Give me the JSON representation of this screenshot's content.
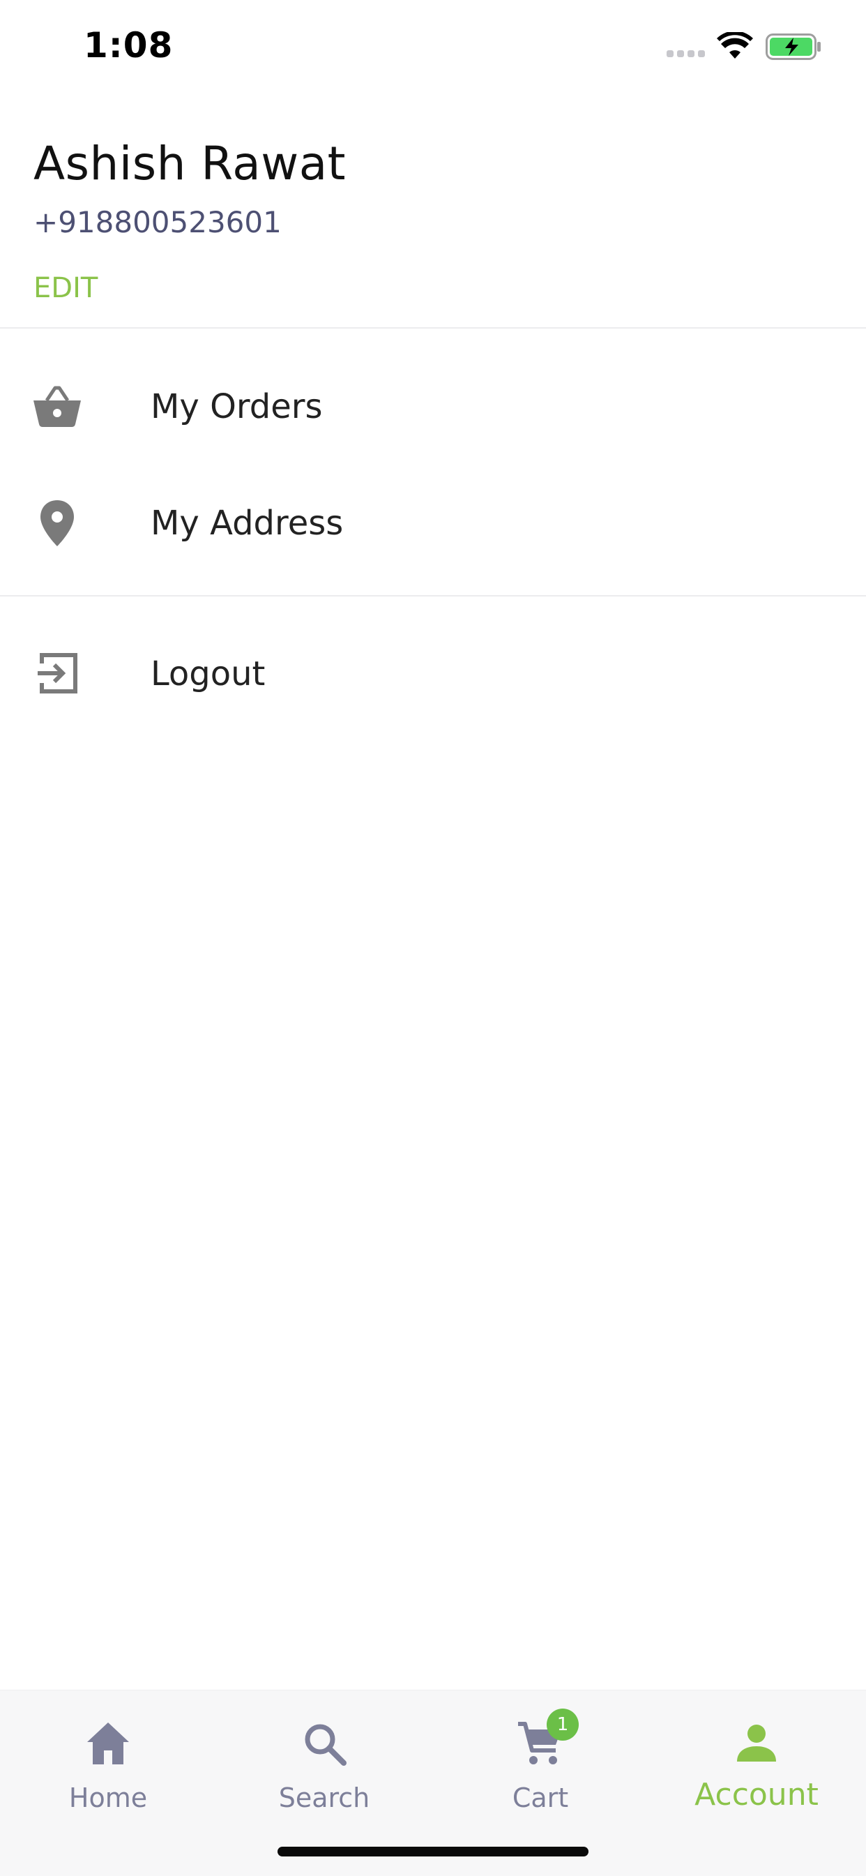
{
  "status_bar": {
    "time": "1:08",
    "icons": [
      "signal-icon",
      "wifi-icon",
      "battery-charging-icon"
    ]
  },
  "profile": {
    "name": "Ashish Rawat",
    "phone": "+918800523601",
    "edit_label": "EDIT"
  },
  "menu": {
    "items": [
      {
        "label": "My Orders",
        "icon": "basket-icon"
      },
      {
        "label": "My Address",
        "icon": "location-pin-icon"
      }
    ],
    "logout": {
      "label": "Logout",
      "icon": "logout-icon"
    }
  },
  "bottom_nav": {
    "items": [
      {
        "label": "Home",
        "icon": "home-icon",
        "active": false
      },
      {
        "label": "Search",
        "icon": "search-icon",
        "active": false
      },
      {
        "label": "Cart",
        "icon": "cart-icon",
        "active": false,
        "badge": "1"
      },
      {
        "label": "Account",
        "icon": "account-icon",
        "active": true
      }
    ]
  },
  "colors": {
    "accent": "#8bc34a",
    "icon_gray": "#7a7a7a",
    "nav_inactive": "#7d7f99",
    "badge": "#6bbf47",
    "battery": "#4cd964"
  }
}
